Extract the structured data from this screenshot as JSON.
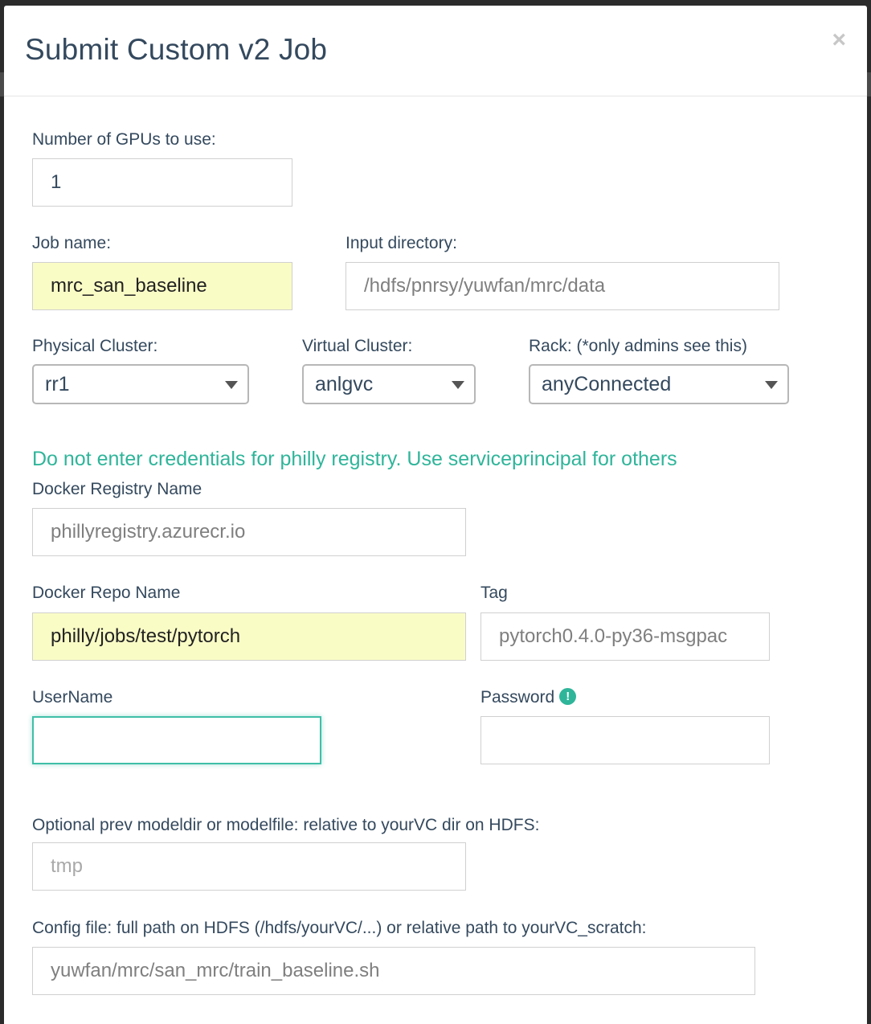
{
  "modal": {
    "title": "Submit Custom v2 Job",
    "close_glyph": "×"
  },
  "gpus": {
    "label": "Number of GPUs to use:",
    "value": "1"
  },
  "job_name": {
    "label": "Job name:",
    "value": "mrc_san_baseline"
  },
  "input_dir": {
    "label": "Input directory:",
    "value": "/hdfs/pnrsy/yuwfan/mrc/data"
  },
  "physical_cluster": {
    "label": "Physical Cluster:",
    "selected": "rr1"
  },
  "virtual_cluster": {
    "label": "Virtual Cluster:",
    "selected": "anlgvc"
  },
  "rack": {
    "label": "Rack: (*only admins see this)",
    "selected": "anyConnected"
  },
  "notice": "Do not enter credentials for philly registry. Use serviceprincipal for others",
  "registry": {
    "label": "Docker Registry Name",
    "value": "phillyregistry.azurecr.io"
  },
  "repo": {
    "label": "Docker Repo Name",
    "value": "philly/jobs/test/pytorch"
  },
  "tag": {
    "label": "Tag",
    "value": "pytorch0.4.0-py36-msgpac"
  },
  "username": {
    "label": "UserName",
    "value": ""
  },
  "password": {
    "label": "Password",
    "icon": "exclamation-circle-icon",
    "icon_glyph": "!",
    "value": ""
  },
  "prev_model": {
    "label": "Optional prev modeldir or modelfile: relative to yourVC dir on HDFS:",
    "placeholder": "tmp"
  },
  "config": {
    "label": "Config file: full path on HDFS (/hdfs/yourVC/...) or relative path to yourVC_scratch:",
    "value": "yuwfan/mrc/san_mrc/train_baseline.sh"
  },
  "colors": {
    "accent": "#2fb59a",
    "autofill": "#fafcc6",
    "text": "#34495e"
  }
}
